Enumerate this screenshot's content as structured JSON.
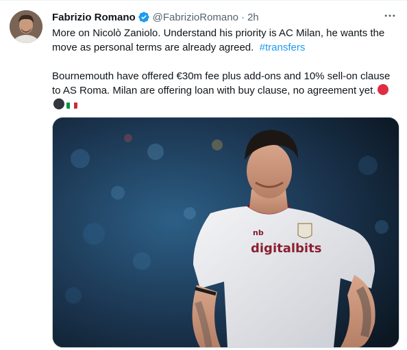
{
  "author": {
    "name": "Fabrizio Romano",
    "handle": "@FabrizioRomano",
    "separator": "·",
    "time": "2h",
    "verified": true,
    "avatar_icon": "user-avatar"
  },
  "tweet": {
    "paragraph1": "More on Nicolò Zaniolo. Understand his priority is AC Milan, he wants the move as personal terms are already agreed.",
    "hashtag": "#transfers",
    "paragraph2": "Bournemouth have offered €30m fee plus add-ons and 10% sell-on clause to AS Roma. Milan are offering loan with buy clause, no agreement yet.",
    "emojis": [
      "red-circle",
      "black-circle",
      "italy-flag"
    ]
  },
  "media": {
    "shirt_sponsor": "digitalbits",
    "kit_brand": "nb"
  },
  "more_icon": "more-horizontal-icon",
  "colors": {
    "link": "#1d9bf0",
    "verified": "#1d9bf0",
    "secondary_text": "#536471",
    "primary_text": "#0f1419"
  }
}
